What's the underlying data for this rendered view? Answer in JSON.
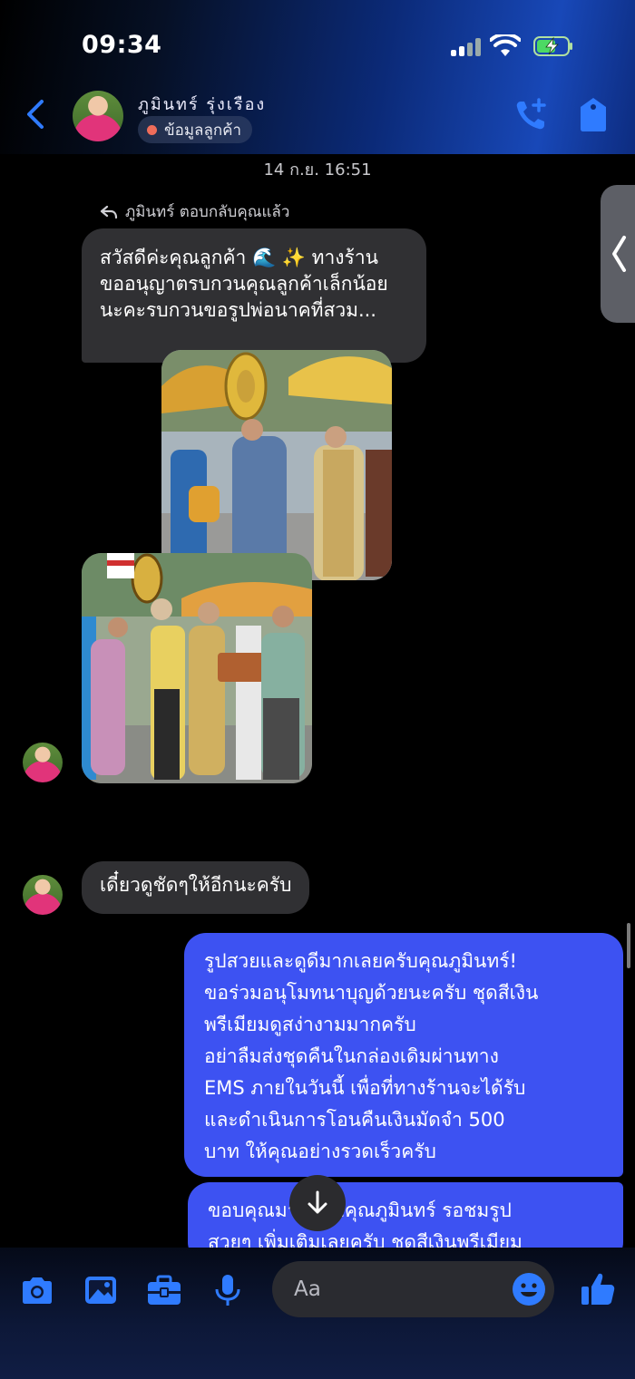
{
  "status_bar": {
    "time": "09:34"
  },
  "header": {
    "contact_name": "ภูมินทร์ รุ่งเรือง",
    "contact_badge": "ข้อมูลลูกค้า"
  },
  "chat": {
    "timestamp": "14 ก.ย. 16:51",
    "reply_label": "ภูมินทร์ ตอบกลับคุณแล้ว",
    "quoted_message": "สวัสดีค่ะคุณลูกค้า 🌊 ✨ ทางร้าน\nขออนุญาตรบกวนคุณลูกค้าเล็กน้อย\nนะคะรบกวนขอรูปพ่อนาคที่สวม...",
    "incoming_text": "เดี๋ยวดูชัดๆให้อีกนะครับ",
    "outgoing_1": "รูปสวยและดูดีมากเลยครับคุณภูมินทร์!\nขอร่วมอนุโมทนาบุญด้วยนะครับ ชุดสีเงิน\nพรีเมียมดูสง่างามมากครับ\nอย่าลืมส่งชุดคืนในกล่องเดิมผ่านทาง\nEMS ภายในวันนี้ เพื่อที่ทางร้านจะได้รับ\nและดำเนินการโอนคืนเงินมัดจำ 500\nบาท ให้คุณอย่างรวดเร็วครับ",
    "outgoing_2": "ขอบคุณมากครับคุณภูมินทร์ รอชมรูป\nสวยๆ เพิ่มเติมเลยครับ ชุดสีเงินพรีเมียม"
  },
  "composer": {
    "placeholder": "Aa"
  },
  "colors": {
    "outgoing_bubble": "#3d52f2",
    "incoming_bubble": "#303033",
    "accent": "#2f7bff"
  }
}
